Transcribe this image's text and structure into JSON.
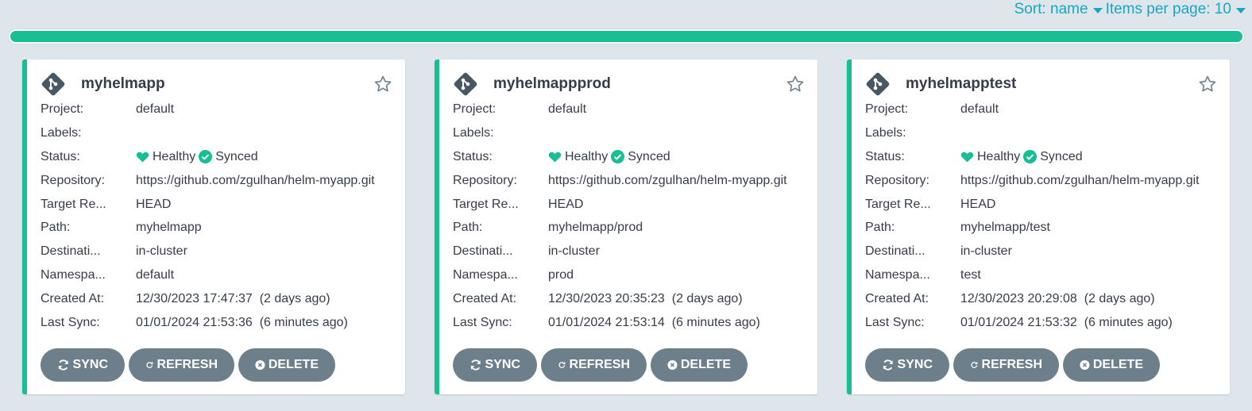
{
  "toolbar": {
    "sort_label": "Sort: name",
    "items_per_page_label": "Items per page: 10"
  },
  "sync_progress_percent": 100,
  "colors": {
    "accent": "#18be94",
    "link": "#18a6c4",
    "button": "#6d7f8b"
  },
  "labels": {
    "project": "Project:",
    "labels": "Labels:",
    "status": "Status:",
    "repository": "Repository:",
    "target_revision": "Target Re...",
    "path": "Path:",
    "destination": "Destinati...",
    "namespace": "Namespa...",
    "created_at": "Created At:",
    "last_sync": "Last Sync:"
  },
  "buttons": {
    "sync": "SYNC",
    "refresh": "REFRESH",
    "delete": "DELETE"
  },
  "apps": [
    {
      "name": "myhelmapp",
      "icon": "git-icon",
      "project": "default",
      "labels": "",
      "health": "Healthy",
      "sync_status": "Synced",
      "repository": "https://github.com/zgulhan/helm-myapp.git",
      "target_revision": "HEAD",
      "path": "myhelmapp",
      "destination": "in-cluster",
      "namespace": "default",
      "created_at": "12/30/2023 17:47:37  (2 days ago)",
      "last_sync": "01/01/2024 21:53:36  (6 minutes ago)"
    },
    {
      "name": "myhelmappprod",
      "icon": "git-icon",
      "project": "default",
      "labels": "",
      "health": "Healthy",
      "sync_status": "Synced",
      "repository": "https://github.com/zgulhan/helm-myapp.git",
      "target_revision": "HEAD",
      "path": "myhelmapp/prod",
      "destination": "in-cluster",
      "namespace": "prod",
      "created_at": "12/30/2023 20:35:23  (2 days ago)",
      "last_sync": "01/01/2024 21:53:14  (6 minutes ago)"
    },
    {
      "name": "myhelmapptest",
      "icon": "git-icon",
      "project": "default",
      "labels": "",
      "health": "Healthy",
      "sync_status": "Synced",
      "repository": "https://github.com/zgulhan/helm-myapp.git",
      "target_revision": "HEAD",
      "path": "myhelmapp/test",
      "destination": "in-cluster",
      "namespace": "test",
      "created_at": "12/30/2023 20:29:08  (2 days ago)",
      "last_sync": "01/01/2024 21:53:32  (6 minutes ago)"
    }
  ]
}
